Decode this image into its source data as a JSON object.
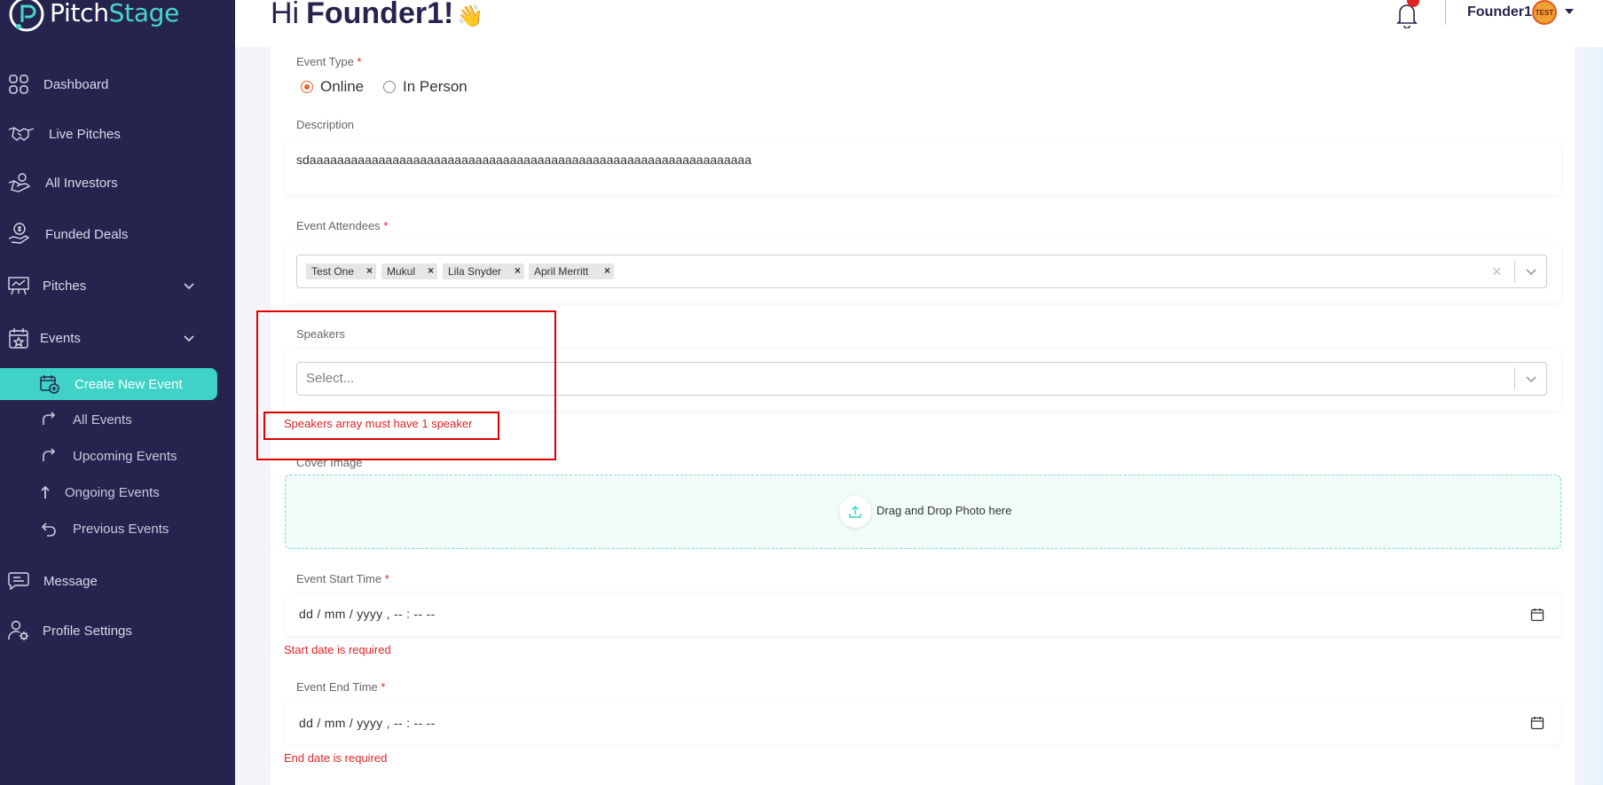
{
  "brand": {
    "name_a": "Pitch",
    "name_b": "Stage"
  },
  "sidebar": {
    "items": [
      {
        "label": "Dashboard"
      },
      {
        "label": "Live Pitches"
      },
      {
        "label": "All Investors"
      },
      {
        "label": "Funded Deals"
      },
      {
        "label": "Pitches"
      },
      {
        "label": "Events"
      },
      {
        "label": "Message"
      },
      {
        "label": "Profile Settings"
      }
    ],
    "events_sub": [
      {
        "label": "Create New Event"
      },
      {
        "label": "All Events"
      },
      {
        "label": "Upcoming Events"
      },
      {
        "label": "Ongoing Events"
      },
      {
        "label": "Previous Events"
      }
    ]
  },
  "header": {
    "greeting_hi": "Hi",
    "greeting_name": "Founder1!",
    "greeting_emoji": "👋",
    "user_name": "Founder1",
    "avatar_text": "TEST"
  },
  "form": {
    "event_type": {
      "label": "Event Type",
      "required_mark": "*",
      "options": [
        "Online",
        "In Person"
      ],
      "selected": "Online"
    },
    "description": {
      "label": "Description",
      "value": "sdaaaaaaaaaaaaaaaaaaaaaaaaaaaaaaaaaaaaaaaaaaaaaaaaaaaaaaaaaaaaaaaa"
    },
    "attendees": {
      "label": "Event Attendees",
      "required_mark": "*",
      "chips": [
        "Test One",
        "Mukul",
        "Lila Snyder",
        "April Merritt"
      ],
      "chip_remove": "×",
      "clear": "×"
    },
    "speakers": {
      "label": "Speakers",
      "placeholder": "Select...",
      "error": "Speakers array must have 1 speaker"
    },
    "cover_image": {
      "label": "Cover Image",
      "drop_text": "Drag and Drop Photo here"
    },
    "start_time": {
      "label": "Event Start Time",
      "required_mark": "*",
      "value": "dd / mm / yyyy ,  -- : --   --",
      "error": "Start date is required"
    },
    "end_time": {
      "label": "Event End Time",
      "required_mark": "*",
      "value": "dd / mm / yyyy ,  -- : --   --",
      "error": "End date is required"
    }
  },
  "colors": {
    "sidebar_bg": "#26244f",
    "accent_teal": "#3ed3c6",
    "radio_orange": "#e8612c",
    "error_red": "#e02424",
    "highlight_box": "#e00000"
  },
  "icons": {
    "dashboard": "grid-icon",
    "live_pitches": "handshake-icon",
    "all_investors": "hand-coin-icon",
    "funded_deals": "money-hand-icon",
    "pitches": "presentation-icon",
    "events": "calendar-star-icon",
    "message": "chat-icon",
    "profile_settings": "user-gear-icon"
  }
}
